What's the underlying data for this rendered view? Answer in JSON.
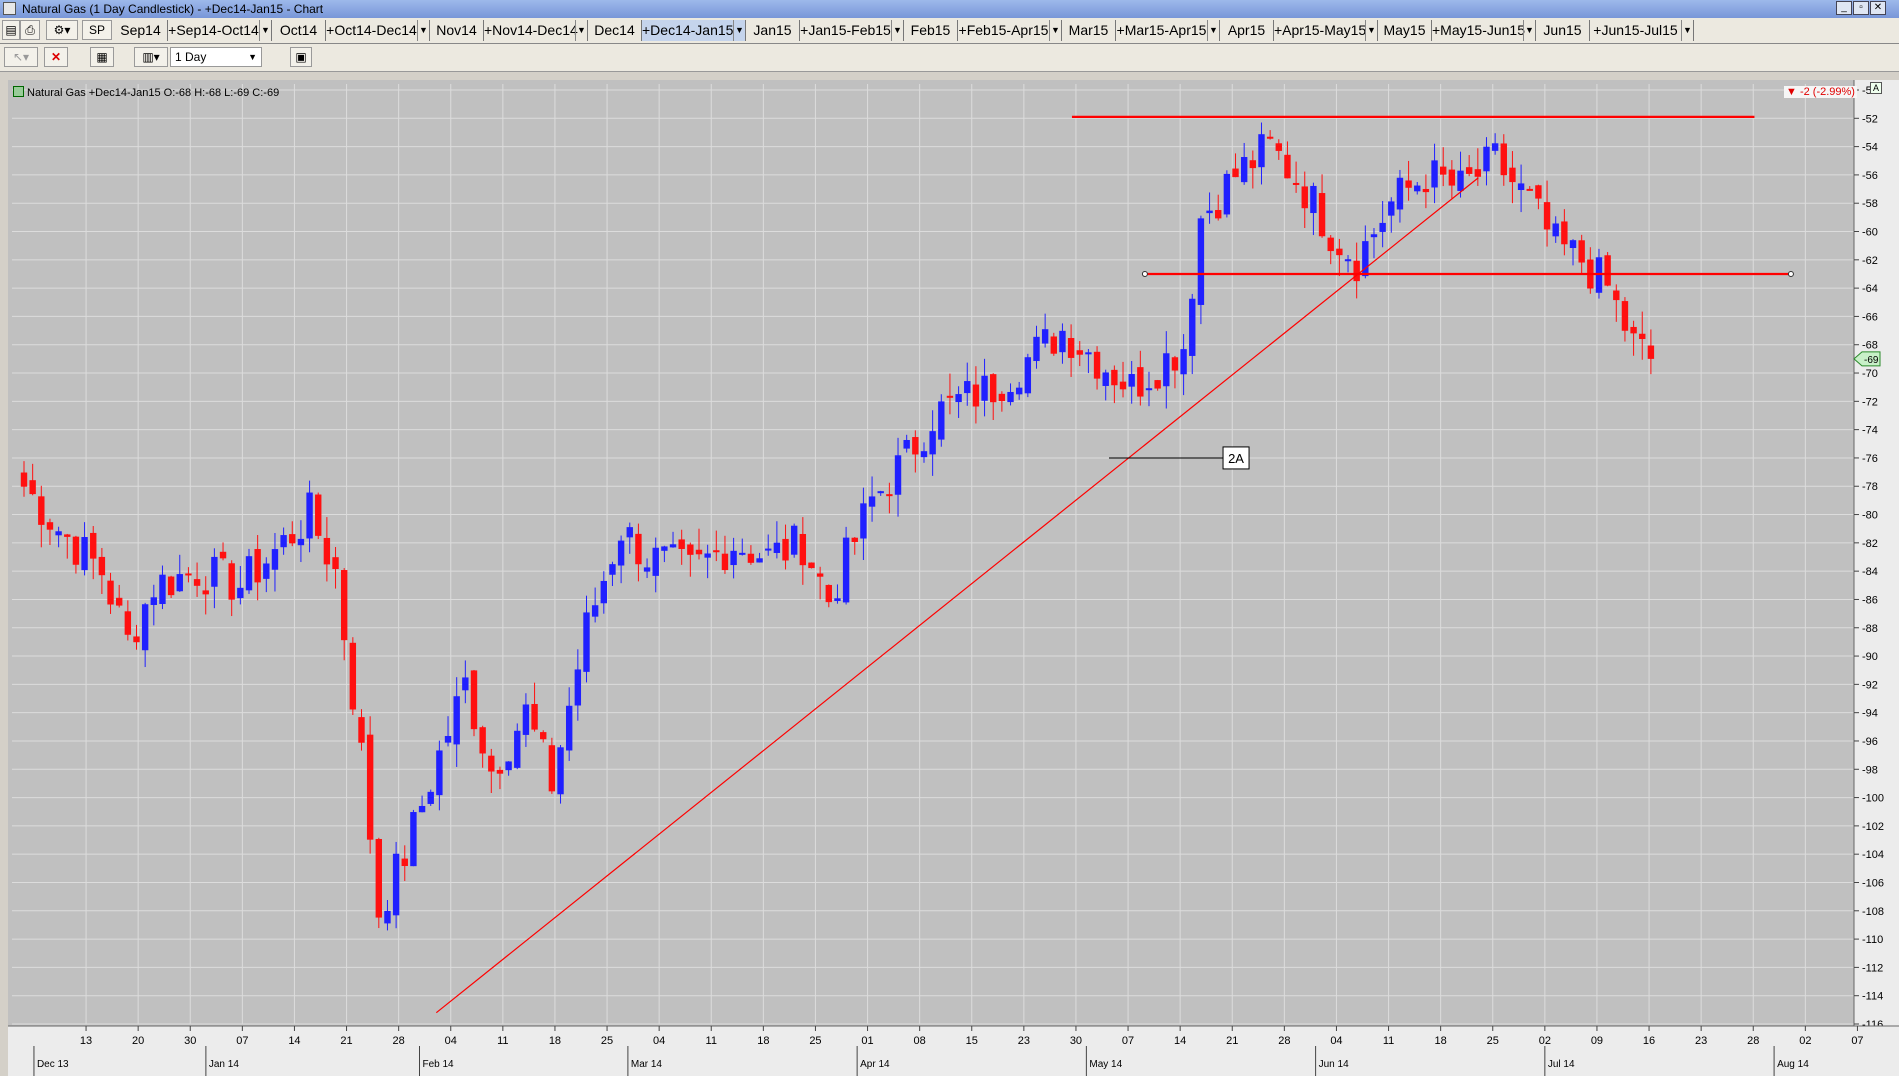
{
  "window": {
    "title": "Natural Gas (1 Day Candlestick) - +Dec14-Jan15 - Chart"
  },
  "tabbar": {
    "tabs": [
      {
        "label": "Sep14",
        "dropdown": false
      },
      {
        "label": "+Sep14-Oct14",
        "dropdown": true
      },
      {
        "label": "Oct14",
        "dropdown": false
      },
      {
        "label": "+Oct14-Dec14",
        "dropdown": true
      },
      {
        "label": "Nov14",
        "dropdown": false
      },
      {
        "label": "+Nov14-Dec14",
        "dropdown": true
      },
      {
        "label": "Dec14",
        "dropdown": false
      },
      {
        "label": "+Dec14-Jan15",
        "dropdown": true,
        "active": true
      },
      {
        "label": "Jan15",
        "dropdown": false
      },
      {
        "label": "+Jan15-Feb15",
        "dropdown": true
      },
      {
        "label": "Feb15",
        "dropdown": false
      },
      {
        "label": "+Feb15-Apr15",
        "dropdown": true
      },
      {
        "label": "Mar15",
        "dropdown": false
      },
      {
        "label": "+Mar15-Apr15",
        "dropdown": true
      },
      {
        "label": "Apr15",
        "dropdown": false
      },
      {
        "label": "+Apr15-May15",
        "dropdown": true
      },
      {
        "label": "May15",
        "dropdown": false
      },
      {
        "label": "+May15-Jun15",
        "dropdown": true
      },
      {
        "label": "Jun15",
        "dropdown": false
      },
      {
        "label": "+Jun15-Jul15",
        "dropdown": true
      }
    ],
    "sp_label": "SP"
  },
  "toolbar": {
    "interval": "1 Day"
  },
  "legend": {
    "text": "Natural Gas +Dec14-Jan15 O:-68 H:-68 L:-69 C:-69"
  },
  "change_badge": "-2 (-2.99%)",
  "price_marker": "-69",
  "colors": {
    "up": "#2020ff",
    "down": "#ff1010",
    "grid": "#dcdcdc",
    "plot_bg": "#c0c0c0",
    "line": "#ff0000"
  },
  "chart_data": {
    "type": "candlestick",
    "title": "Natural Gas (1 Day Candlestick) - +Dec14-Jan15",
    "ylim": [
      -116,
      -50
    ],
    "yticks": [
      -50,
      -52,
      -54,
      -56,
      -58,
      -60,
      -62,
      -64,
      -66,
      -68,
      -70,
      -72,
      -74,
      -76,
      -78,
      -80,
      -82,
      -84,
      -86,
      -88,
      -90,
      -92,
      -94,
      -96,
      -98,
      -100,
      -102,
      -104,
      -106,
      -108,
      -110,
      -112,
      -114,
      -116
    ],
    "xticks": [
      {
        "label": "13",
        "week": 1
      },
      {
        "label": "20",
        "week": 2
      },
      {
        "label": "30",
        "week": 3
      },
      {
        "label": "07",
        "week": 4
      },
      {
        "label": "14",
        "week": 5
      },
      {
        "label": "21",
        "week": 6
      },
      {
        "label": "28",
        "week": 7
      },
      {
        "label": "04",
        "week": 8
      },
      {
        "label": "11",
        "week": 9
      },
      {
        "label": "18",
        "week": 10
      },
      {
        "label": "25",
        "week": 11
      },
      {
        "label": "04",
        "week": 12
      },
      {
        "label": "11",
        "week": 13
      },
      {
        "label": "18",
        "week": 14
      },
      {
        "label": "25",
        "week": 15
      },
      {
        "label": "01",
        "week": 16
      },
      {
        "label": "08",
        "week": 17
      },
      {
        "label": "15",
        "week": 18
      },
      {
        "label": "23",
        "week": 19
      },
      {
        "label": "30",
        "week": 20
      },
      {
        "label": "07",
        "week": 21
      },
      {
        "label": "14",
        "week": 22
      },
      {
        "label": "21",
        "week": 23
      },
      {
        "label": "28",
        "week": 24
      },
      {
        "label": "04",
        "week": 25
      },
      {
        "label": "11",
        "week": 26
      },
      {
        "label": "18",
        "week": 27
      },
      {
        "label": "25",
        "week": 28
      },
      {
        "label": "02",
        "week": 29
      },
      {
        "label": "09",
        "week": 30
      },
      {
        "label": "16",
        "week": 31
      },
      {
        "label": "23",
        "week": 32
      },
      {
        "label": "28",
        "week": 33
      },
      {
        "label": "02",
        "week": 34
      },
      {
        "label": "07",
        "week": 35
      }
    ],
    "months": [
      {
        "label": "Dec 13",
        "week": 0
      },
      {
        "label": "Jan 14",
        "week": 3.3
      },
      {
        "label": "Feb 14",
        "week": 7.4
      },
      {
        "label": "Mar 14",
        "week": 11.4
      },
      {
        "label": "Apr 14",
        "week": 15.8
      },
      {
        "label": "May 14",
        "week": 20.2
      },
      {
        "label": "Jun 14",
        "week": 24.6
      },
      {
        "label": "Jul 14",
        "week": 29
      },
      {
        "label": "Aug 14",
        "week": 33.4
      }
    ],
    "anchors": [
      {
        "i": 0,
        "v": -78
      },
      {
        "i": 4,
        "v": -81
      },
      {
        "i": 9,
        "v": -84
      },
      {
        "i": 12,
        "v": -89
      },
      {
        "i": 15,
        "v": -85
      },
      {
        "i": 20,
        "v": -84
      },
      {
        "i": 25,
        "v": -85
      },
      {
        "i": 30,
        "v": -82
      },
      {
        "i": 33,
        "v": -80
      },
      {
        "i": 36,
        "v": -84
      },
      {
        "i": 39,
        "v": -97
      },
      {
        "i": 41,
        "v": -108
      },
      {
        "i": 44,
        "v": -104
      },
      {
        "i": 48,
        "v": -97
      },
      {
        "i": 51,
        "v": -92
      },
      {
        "i": 54,
        "v": -98
      },
      {
        "i": 58,
        "v": -94
      },
      {
        "i": 61,
        "v": -99
      },
      {
        "i": 65,
        "v": -88
      },
      {
        "i": 69,
        "v": -81
      },
      {
        "i": 72,
        "v": -83
      },
      {
        "i": 77,
        "v": -84
      },
      {
        "i": 82,
        "v": -82
      },
      {
        "i": 86,
        "v": -83
      },
      {
        "i": 90,
        "v": -82
      },
      {
        "i": 93,
        "v": -86
      },
      {
        "i": 98,
        "v": -79
      },
      {
        "i": 102,
        "v": -76
      },
      {
        "i": 105,
        "v": -73
      },
      {
        "i": 108,
        "v": -72
      },
      {
        "i": 112,
        "v": -71
      },
      {
        "i": 116,
        "v": -69
      },
      {
        "i": 120,
        "v": -67
      },
      {
        "i": 124,
        "v": -69
      },
      {
        "i": 128,
        "v": -71
      },
      {
        "i": 132,
        "v": -69
      },
      {
        "i": 134,
        "v": -68
      },
      {
        "i": 136,
        "v": -59
      },
      {
        "i": 140,
        "v": -56
      },
      {
        "i": 144,
        "v": -54
      },
      {
        "i": 148,
        "v": -57
      },
      {
        "i": 151,
        "v": -60
      },
      {
        "i": 154,
        "v": -62
      },
      {
        "i": 158,
        "v": -58
      },
      {
        "i": 162,
        "v": -56
      },
      {
        "i": 166,
        "v": -57
      },
      {
        "i": 170,
        "v": -55
      },
      {
        "i": 174,
        "v": -58
      },
      {
        "i": 177,
        "v": -61
      },
      {
        "i": 180,
        "v": -62
      },
      {
        "i": 183,
        "v": -64
      },
      {
        "i": 186,
        "v": -68
      },
      {
        "i": 188,
        "v": -69
      }
    ],
    "lines": [
      {
        "from": [
          -0.5,
          -51.9
        ],
        "to": [
          32.6,
          -51.9
        ],
        "style": "horizontal",
        "start_week": 19.5
      },
      {
        "from": [
          20.9,
          -63
        ],
        "to": [
          33.3,
          -63
        ],
        "style": "horizontal"
      },
      {
        "from": [
          7.3,
          -115.2
        ],
        "to": [
          27.3,
          -56.2
        ],
        "style": "trendline"
      }
    ],
    "annotation": {
      "label": "2A",
      "week": 22.4,
      "value": -76
    }
  }
}
